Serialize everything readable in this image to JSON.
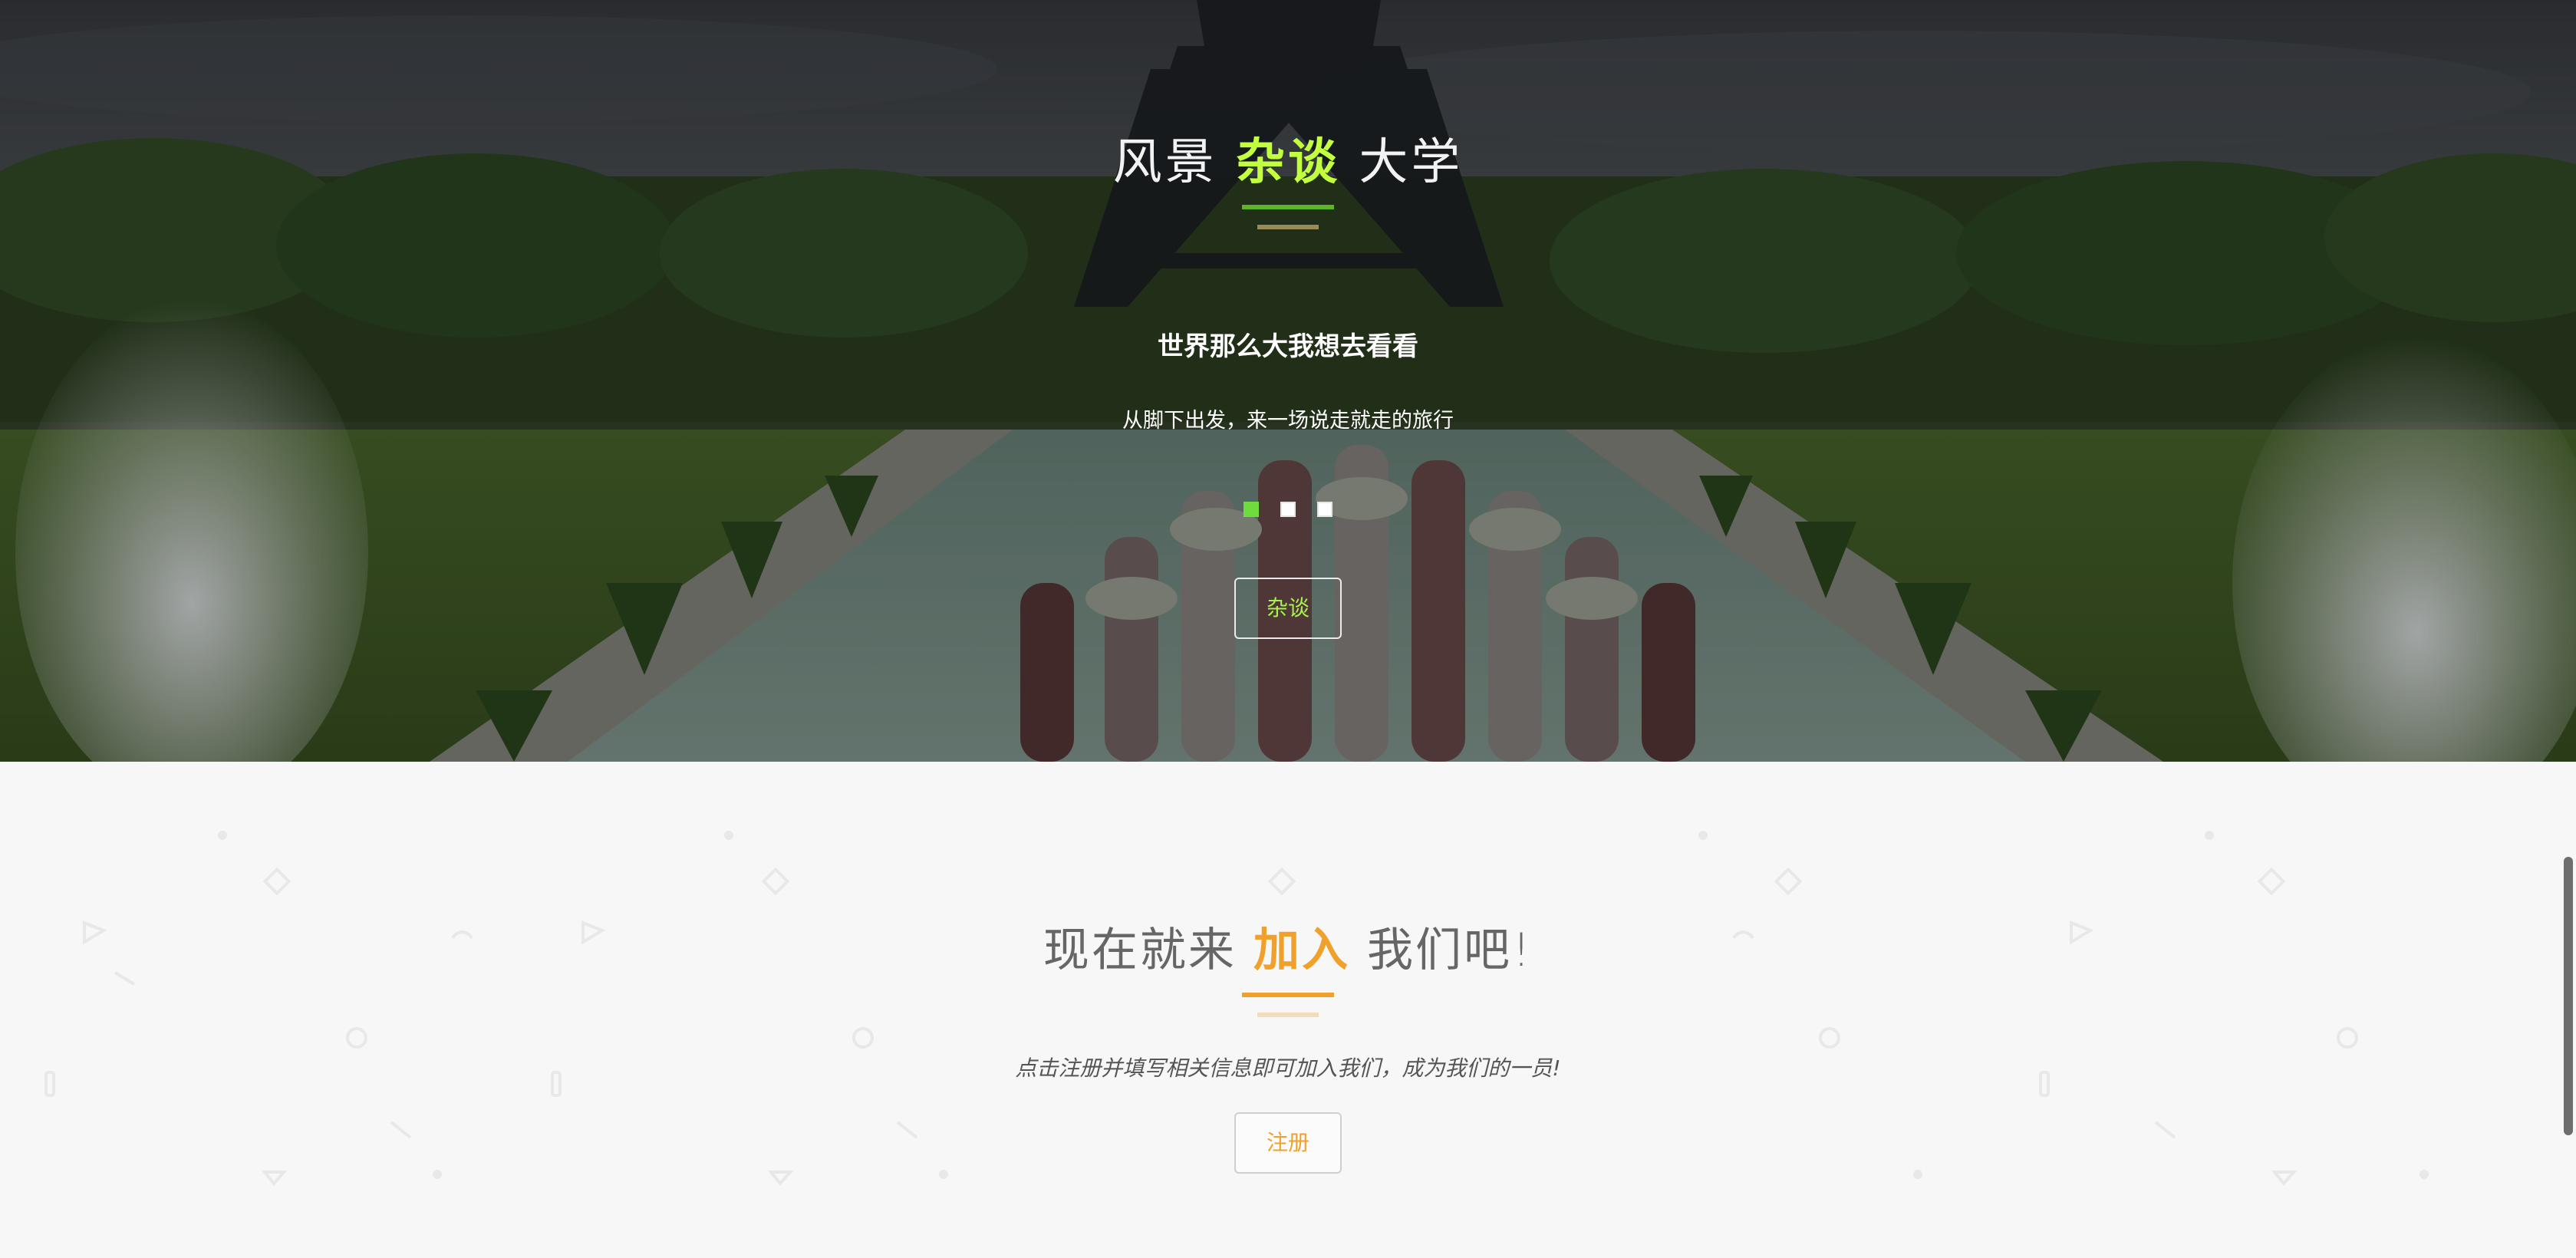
{
  "hero": {
    "title_before": "风景",
    "title_accent": "杂谈",
    "title_after": "大学",
    "heading": "世界那么大我想去看看",
    "subtitle": "从脚下出发，来一场说走就走的旅行",
    "slides": {
      "count": 3,
      "active_index": 0
    },
    "button_label": "杂谈",
    "background_icon": "eiffel-tower-fountain-photo"
  },
  "join": {
    "title_before": "现在就来",
    "title_accent": "加入",
    "title_after": "我们吧!",
    "subtitle": "点击注册并填写相关信息即可加入我们，成为我们的一员!",
    "button_label": "注册"
  },
  "colors": {
    "hero_accent": "#c2ff3f",
    "hero_button_text": "#a6f152",
    "hero_rule": "#5ab52a",
    "join_accent": "#f0a12c",
    "join_background": "#f7f7f7",
    "dot_active": "#6fdc3e"
  }
}
